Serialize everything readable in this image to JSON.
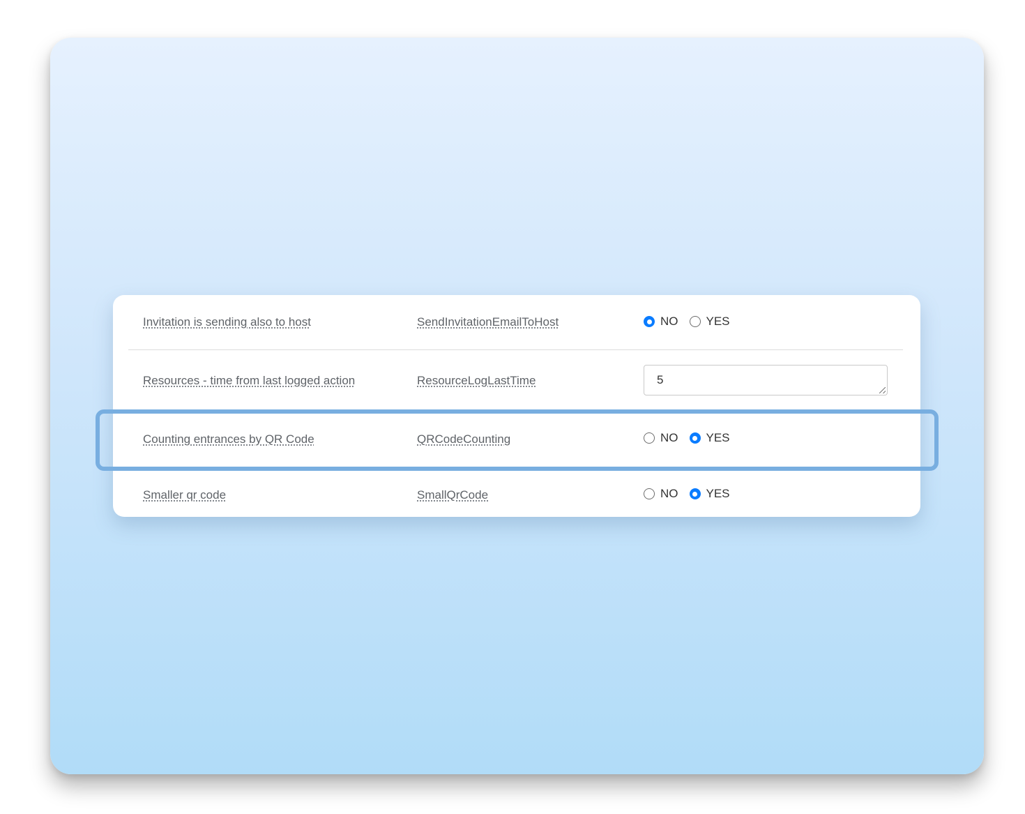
{
  "settings": [
    {
      "label": "Invitation is sending also to host",
      "key": "SendInvitationEmailToHost",
      "type": "radio",
      "options": [
        "NO",
        "YES"
      ],
      "selected": "NO"
    },
    {
      "label": "Resources - time from last logged action",
      "key": "ResourceLogLastTime",
      "type": "text",
      "value": "5"
    },
    {
      "label": "Counting entrances by QR Code",
      "key": "QRCodeCounting",
      "type": "radio",
      "options": [
        "NO",
        "YES"
      ],
      "selected": "YES",
      "highlighted": true
    },
    {
      "label": "Smaller qr code",
      "key": "SmallQrCode",
      "type": "radio",
      "options": [
        "NO",
        "YES"
      ],
      "selected": "YES"
    }
  ],
  "colors": {
    "accent": "#0a7cff",
    "highlight_border": "#78aee0"
  }
}
